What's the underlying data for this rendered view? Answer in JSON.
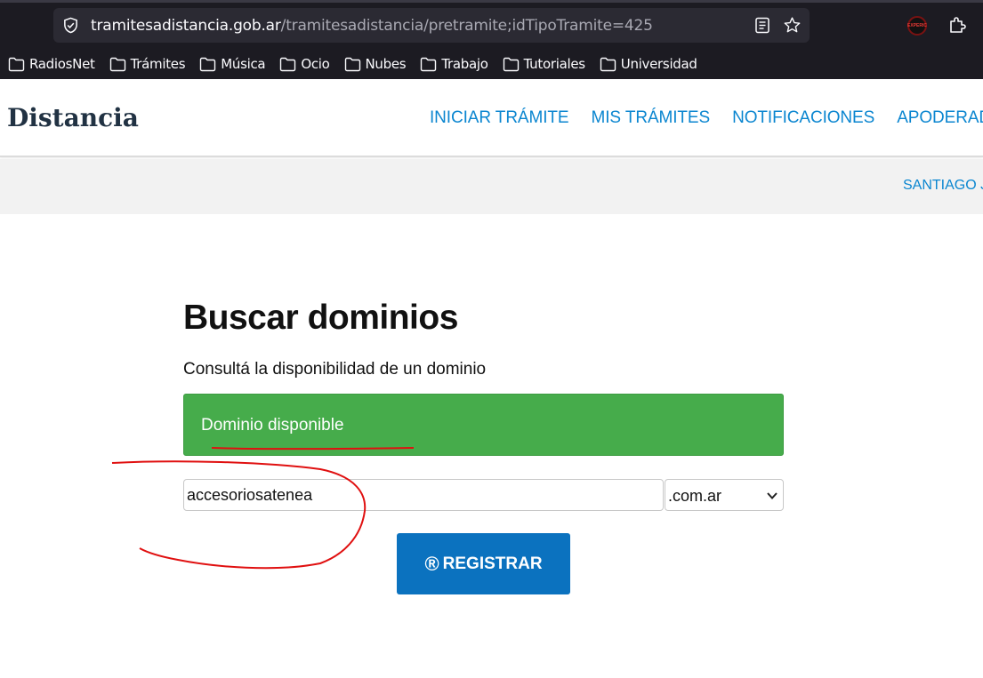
{
  "browser": {
    "url_host": "tramitesadistancia.gob.ar",
    "url_path": "/tramitesadistancia/pretramite;idTipoTramite=425",
    "extension_badge": "EXPERIC",
    "bookmarks": [
      "RadiosNet",
      "Trámites",
      "Música",
      "Ocio",
      "Nubes",
      "Trabajo",
      "Tutoriales",
      "Universidad"
    ]
  },
  "header": {
    "brand": "Distancia",
    "nav": [
      "INICIAR TRÁMITE",
      "MIS TRÁMITES",
      "NOTIFICACIONES",
      "APODERADOS"
    ],
    "user": "SANTIAGO J"
  },
  "main": {
    "title": "Buscar dominios",
    "subtitle": "Consultá la disponibilidad de un dominio",
    "alert": "Dominio disponible",
    "domain_value": "accesoriosatenea",
    "tld_selected": ".com.ar",
    "register_icon": "®",
    "register_label": "REGISTRAR"
  },
  "colors": {
    "accent": "#0b86d0",
    "success": "#46ac4b",
    "button": "#0b72bf",
    "annotation": "#e01010"
  }
}
